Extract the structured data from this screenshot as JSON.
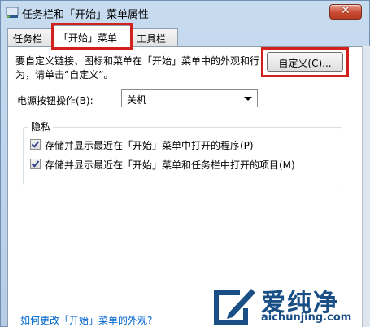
{
  "window": {
    "title": "任务栏和「开始」菜单属性",
    "close_label": "✕"
  },
  "tabs": [
    {
      "label": "任务栏"
    },
    {
      "label": "「开始」菜单"
    },
    {
      "label": "工具栏"
    }
  ],
  "panel": {
    "description": "要自定义链接、图标和菜单在「开始」菜单中的外观和行为，请单击“自定义”。",
    "customize_button": "自定义(C)...",
    "power_label": "电源按钮操作(B):",
    "power_value": "关机",
    "privacy_title": "隐私",
    "checkboxes": [
      {
        "label": "存储并显示最近在「开始」菜单中打开的程序(P)",
        "checked": true
      },
      {
        "label": "存储并显示最近在「开始」菜单和任务栏中打开的项目(M)",
        "checked": true
      }
    ],
    "help_link": "如何更改「开始」菜单的外观?"
  },
  "watermark": {
    "text": "爱纯净",
    "url": "aichunjing.com",
    "icon": "pen-logo-icon"
  },
  "colors": {
    "annotation": "#d4201c",
    "link": "#0066cc",
    "brand": "#1a4f86"
  }
}
